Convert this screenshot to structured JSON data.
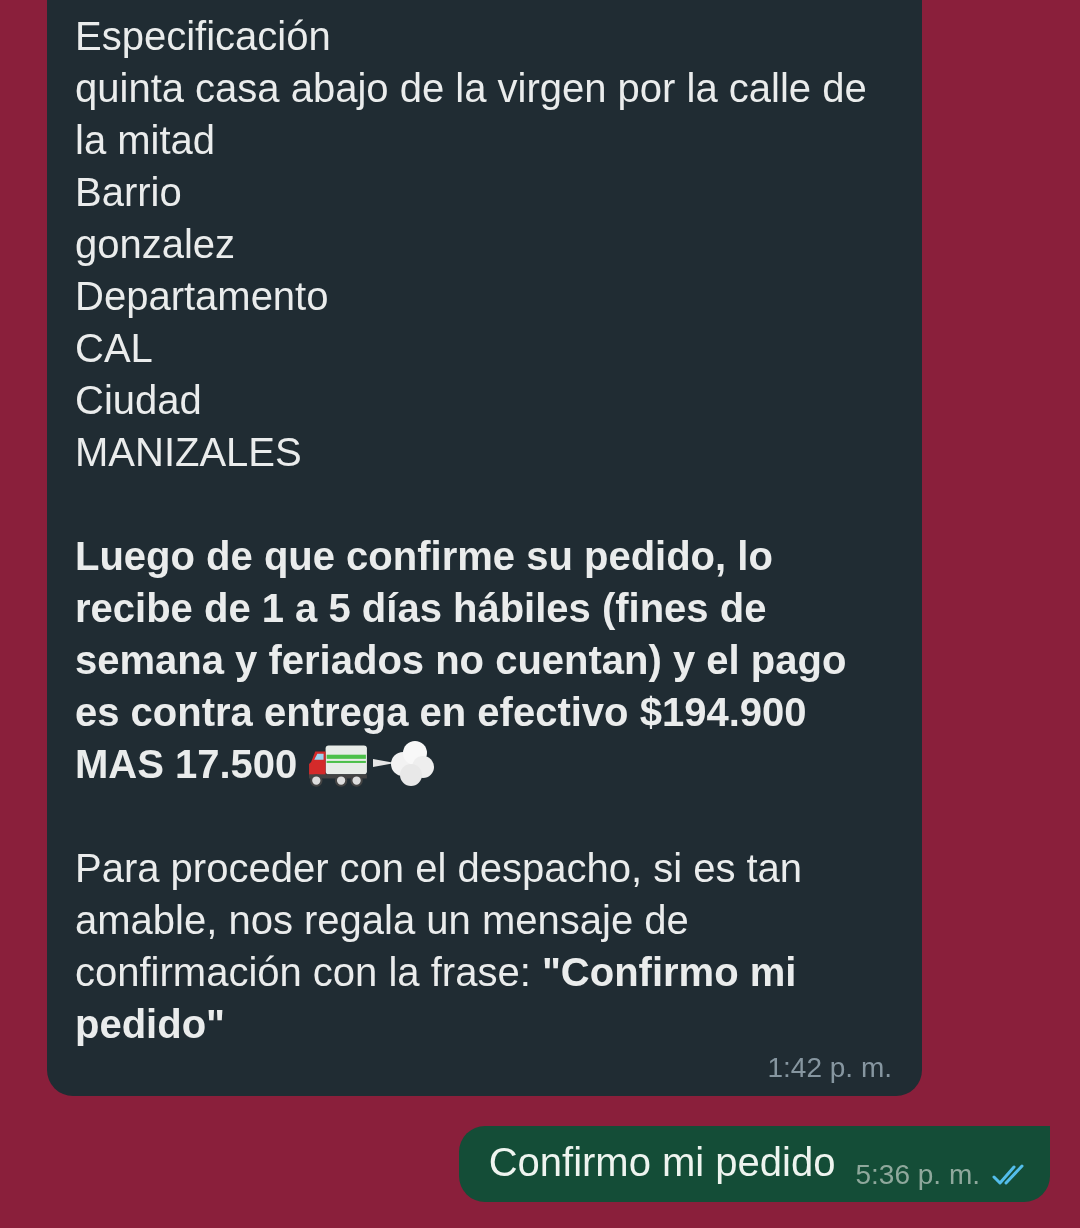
{
  "incoming": {
    "lines": [
      "Especificación",
      "quinta casa abajo de la virgen por la calle de la mitad",
      "Barrio",
      "gonzalez",
      "Departamento",
      "CAL",
      "Ciudad",
      "MANIZALES"
    ],
    "notice": "Luego de que confirme su pedido, lo recibe de 1 a 5 días hábiles (fines de semana y feriados no cuentan) y el pago es contra entrega en efectivo $194.900",
    "notice_amount": "MAS 17.500",
    "request": "Para proceder con el despacho, si es tan amable, nos regala un mensaje de confirmación con la frase: **\"Confirmo mi pedido\"**",
    "time": "1:42 p. m."
  },
  "outgoing": {
    "text": "Confirmo mi pedido",
    "time": "5:36 p. m.",
    "read": true
  }
}
